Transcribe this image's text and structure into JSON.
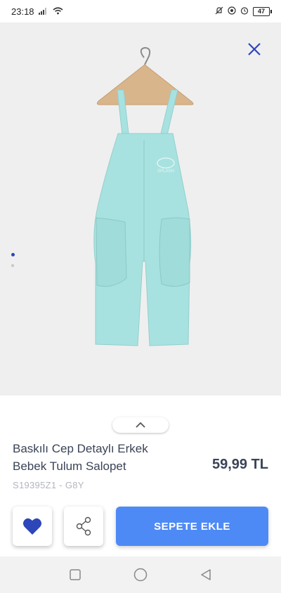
{
  "status_bar": {
    "time": "23:18",
    "battery": "47"
  },
  "product": {
    "title": "Baskılı Cep Detaylı Erkek Bebek Tulum Salopet",
    "price": "59,99 TL",
    "code": "S19395Z1 - G8Y"
  },
  "gallery": {
    "total_images": 2,
    "active_index": 0,
    "print_text": "SPLASH"
  },
  "actions": {
    "add_to_cart_label": "SEPETE EKLE"
  },
  "icons": {
    "close": "close-icon",
    "favorite": "heart-icon",
    "share": "share-icon",
    "expand": "chevron-up-icon",
    "nav_recent": "square-icon",
    "nav_home": "circle-icon",
    "nav_back": "triangle-back-icon"
  },
  "colors": {
    "accent": "#2d46b9",
    "cart_button": "#4e8af5",
    "garment": "#a8e2e0",
    "image_bg": "#efefef",
    "text": "#3a4356",
    "muted": "#b3b6bf"
  }
}
